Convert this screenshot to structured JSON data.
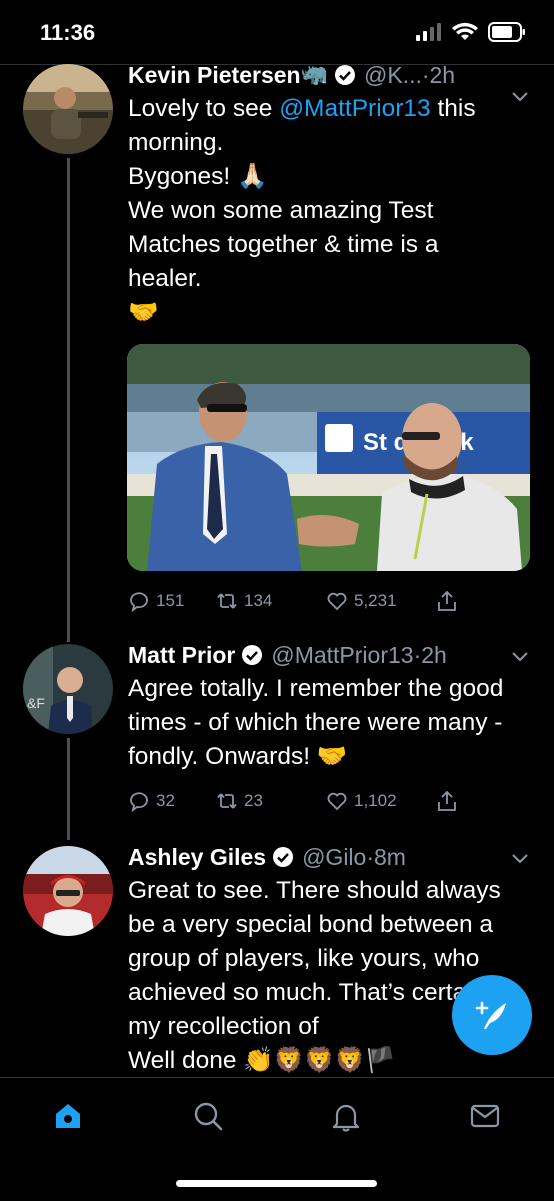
{
  "status_bar": {
    "time": "11:36"
  },
  "tweets": [
    {
      "name": "Kevin Pietersen",
      "name_suffix": "🦏",
      "handle": "@K...",
      "time": "·2h",
      "line1_pre": "Lovely to see ",
      "mention": "@MattPrior13",
      "line1_post": " this morning.",
      "line2": "Bygones! 🙏🏻",
      "line3": "We won some amazing Test Matches together & time is a healer.",
      "line4": "🤝",
      "counts": {
        "replies": "151",
        "retweets": "134",
        "likes": "5,231"
      }
    },
    {
      "name": "Matt Prior",
      "handle": "@MattPrior13",
      "time": "·2h",
      "text": "Agree totally. I remember the good times - of which there were many - fondly. Onwards! 🤝",
      "counts": {
        "replies": "32",
        "retweets": "23",
        "likes": "1,102"
      }
    },
    {
      "name": "Ashley Giles",
      "handle": "@Gilo",
      "time": "·8m",
      "text": "Great to see. There should always be a very special bond between a group of players, like yours, who achieved so much. That’s certainly my recollection of",
      "text_end": "Well done 👏🦁🦁🦁🏴"
    }
  ],
  "media": {
    "banner_text": "St      d Bank"
  },
  "colors": {
    "accent": "#1da1f2",
    "muted": "#8899a6",
    "background": "#000000"
  },
  "icons": [
    "reply-icon",
    "retweet-icon",
    "like-icon",
    "share-icon",
    "home-icon",
    "search-icon",
    "notifications-icon",
    "messages-icon",
    "compose-tweet-icon"
  ]
}
